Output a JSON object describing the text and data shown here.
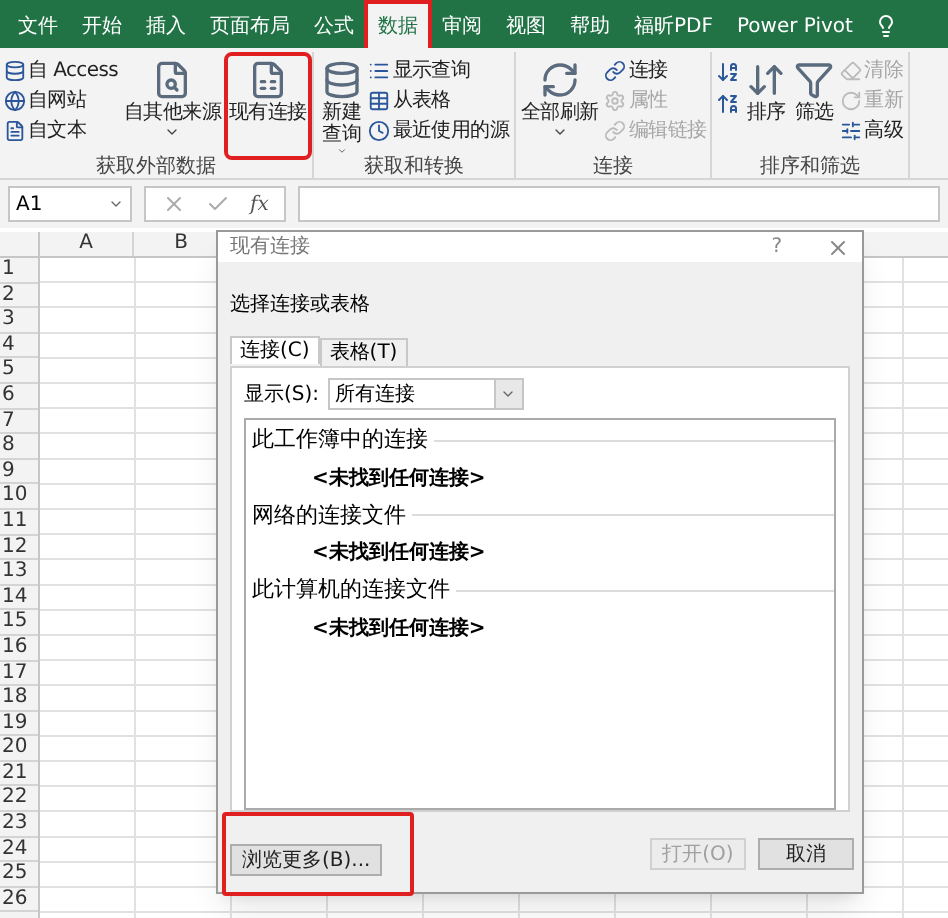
{
  "ribbon_tabs": [
    {
      "label": "文件",
      "selected": false,
      "highlighted": false
    },
    {
      "label": "开始",
      "selected": false,
      "highlighted": false
    },
    {
      "label": "插入",
      "selected": false,
      "highlighted": false
    },
    {
      "label": "页面布局",
      "selected": false,
      "highlighted": false
    },
    {
      "label": "公式",
      "selected": false,
      "highlighted": false
    },
    {
      "label": "数据",
      "selected": true,
      "highlighted": true
    },
    {
      "label": "审阅",
      "selected": false,
      "highlighted": false
    },
    {
      "label": "视图",
      "selected": false,
      "highlighted": false
    },
    {
      "label": "帮助",
      "selected": false,
      "highlighted": false
    },
    {
      "label": "福昕PDF",
      "selected": false,
      "highlighted": false
    },
    {
      "label": "Power Pivot",
      "selected": false,
      "highlighted": false
    }
  ],
  "ribbon_groups": [
    {
      "title": "获取外部数据",
      "items": [
        {
          "kind": "small",
          "label": "自 Access",
          "disabled": false
        },
        {
          "kind": "small",
          "label": "自网站",
          "disabled": false
        },
        {
          "kind": "small",
          "label": "自文本",
          "disabled": false
        },
        {
          "kind": "large",
          "label": "自其他来源",
          "dropdown": true,
          "highlighted": false
        },
        {
          "kind": "large",
          "label": "现有连接",
          "dropdown": false,
          "highlighted": true
        }
      ]
    },
    {
      "title": "获取和转换",
      "items": [
        {
          "kind": "large",
          "label": "新建查询",
          "dropdown": true,
          "highlighted": false
        },
        {
          "kind": "small",
          "label": "显示查询",
          "disabled": false
        },
        {
          "kind": "small",
          "label": "从表格",
          "disabled": false
        },
        {
          "kind": "small",
          "label": "最近使用的源",
          "disabled": false
        }
      ]
    },
    {
      "title": "连接",
      "items": [
        {
          "kind": "large",
          "label": "全部刷新",
          "dropdown": true,
          "highlighted": false
        },
        {
          "kind": "small",
          "label": "连接",
          "disabled": false
        },
        {
          "kind": "small",
          "label": "属性",
          "disabled": true
        },
        {
          "kind": "small",
          "label": "编辑链接",
          "disabled": true
        }
      ]
    },
    {
      "title": "排序和筛选",
      "items": [
        {
          "kind": "icon"
        },
        {
          "kind": "icon"
        },
        {
          "kind": "large",
          "label": "排序",
          "dropdown": false,
          "highlighted": false
        },
        {
          "kind": "large",
          "label": "筛选",
          "dropdown": false,
          "highlighted": false
        },
        {
          "kind": "small",
          "label": "清除",
          "disabled": true
        },
        {
          "kind": "small",
          "label": "重新",
          "disabled": true
        },
        {
          "kind": "small",
          "label": "高级",
          "disabled": false
        }
      ]
    }
  ],
  "name_box": {
    "value": "A1"
  },
  "formula_bar": {
    "function_label": "fx"
  },
  "sheet": {
    "columns": [
      "A",
      "B"
    ],
    "rows": [
      "1",
      "2",
      "3",
      "4",
      "5",
      "6",
      "7",
      "8",
      "9",
      "10",
      "11",
      "12",
      "13",
      "14",
      "15",
      "16",
      "17",
      "18",
      "19",
      "20",
      "21",
      "22",
      "23",
      "24",
      "25",
      "26"
    ]
  },
  "dialog": {
    "title": "现有连接",
    "help": "?",
    "prompt": "选择连接或表格",
    "tabs": [
      {
        "label": "连接(C)",
        "selected": true
      },
      {
        "label": "表格(T)",
        "selected": false
      }
    ],
    "show_label": "显示(S):",
    "show_value": "所有连接",
    "sections": [
      {
        "title": "此工作簿中的连接",
        "empty_text": "<未找到任何连接>"
      },
      {
        "title": "网络的连接文件",
        "empty_text": "<未找到任何连接>"
      },
      {
        "title": "此计算机的连接文件",
        "empty_text": "<未找到任何连接>"
      }
    ],
    "buttons": [
      {
        "label": "浏览更多(B)...",
        "disabled": false,
        "highlighted": true
      },
      {
        "label": "打开(O)",
        "disabled": true,
        "highlighted": false
      },
      {
        "label": "取消",
        "disabled": false,
        "highlighted": false
      }
    ]
  }
}
